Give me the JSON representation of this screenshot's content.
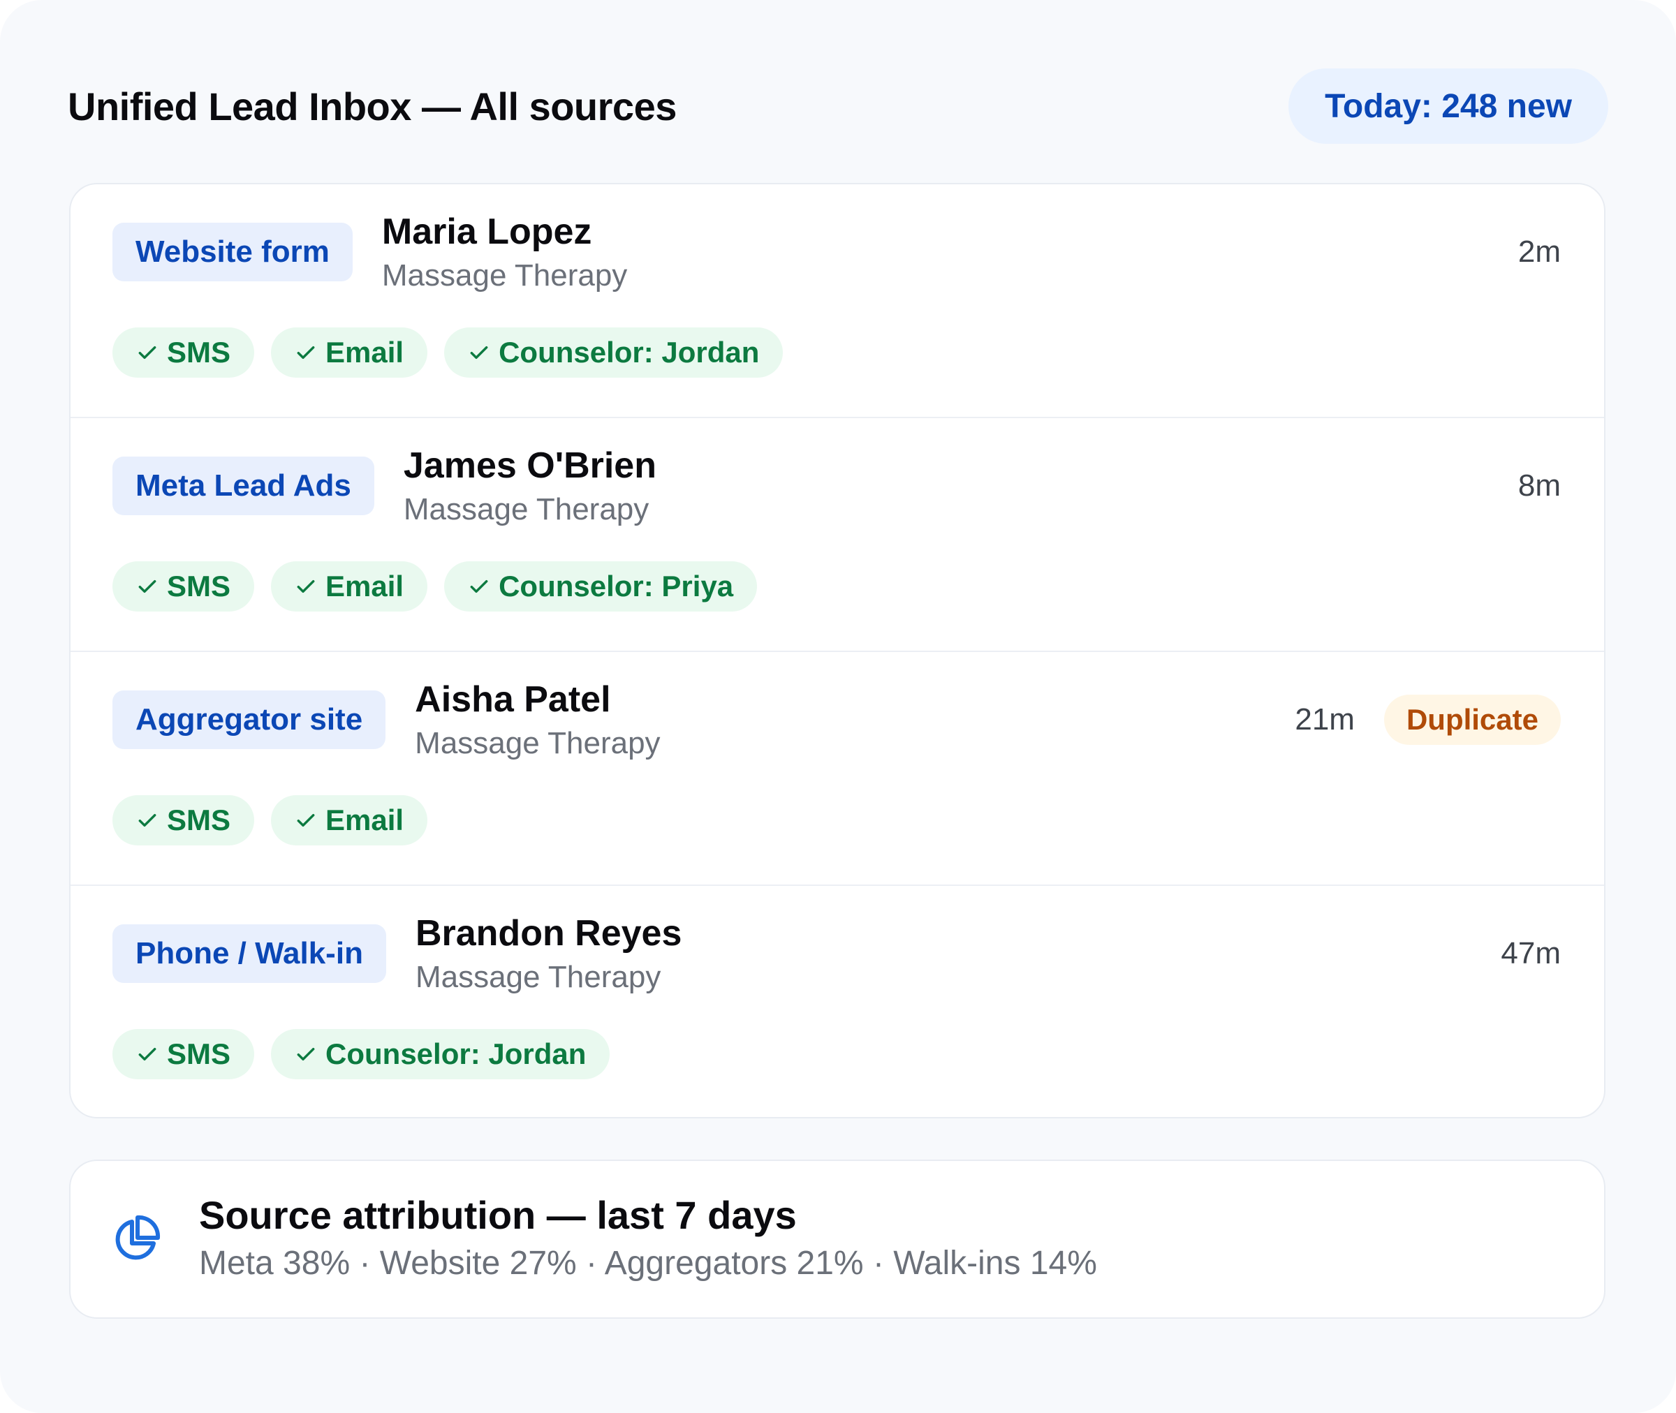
{
  "header": {
    "title": "Unified Lead Inbox — All sources",
    "today_badge": "Today: 248 new"
  },
  "leads": [
    {
      "source": "Website form",
      "name": "Maria Lopez",
      "program": "Massage Therapy",
      "time": "2m",
      "tags": [
        "SMS",
        "Email",
        "Counselor: Jordan"
      ]
    },
    {
      "source": "Meta Lead Ads",
      "name": "James O'Brien",
      "program": "Massage Therapy",
      "time": "8m",
      "tags": [
        "SMS",
        "Email",
        "Counselor: Priya"
      ]
    },
    {
      "source": "Aggregator site",
      "name": "Aisha Patel",
      "program": "Massage Therapy",
      "time": "21m",
      "badge": "Duplicate",
      "tags": [
        "SMS",
        "Email"
      ]
    },
    {
      "source": "Phone / Walk-in",
      "name": "Brandon Reyes",
      "program": "Massage Therapy",
      "time": "47m",
      "tags": [
        "SMS",
        "Counselor: Jordan"
      ]
    }
  ],
  "attribution": {
    "icon": "pie-chart-icon",
    "title": "Source attribution — last 7 days",
    "summary": "Meta 38% · Website 27% · Aggregators 21% · Walk-ins 14%"
  },
  "colors": {
    "accent_blue": "#0b47b5",
    "tag_green": "#0c7a40",
    "duplicate_orange": "#b04b08",
    "icon_blue": "#1f6fde"
  }
}
